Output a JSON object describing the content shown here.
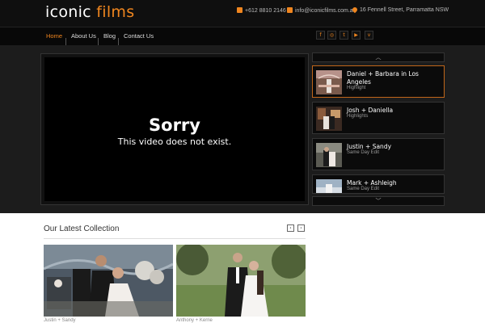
{
  "brand": {
    "word1": "iconic",
    "word2": "films"
  },
  "contact": {
    "phone": "+612 8810 2146",
    "email": "info@iconicfilms.com.au",
    "address": "16 Fennell Street, Parramatta NSW"
  },
  "nav": {
    "items": [
      "Home",
      "About Us",
      "Blog",
      "Contact Us"
    ],
    "active": "Home"
  },
  "social": [
    "facebook-icon",
    "instagram-icon",
    "twitter-icon",
    "youtube-icon",
    "vimeo-icon"
  ],
  "social_glyphs": [
    "f",
    "◎",
    "t",
    "▶",
    "v"
  ],
  "player": {
    "title": "Sorry",
    "message": "This video does not exist."
  },
  "playlist": {
    "up_arrow": "︿",
    "down_arrow": "﹀",
    "items": [
      {
        "title": "Daniel + Barbara in Los Angeles",
        "subtitle": "Highlight"
      },
      {
        "title": "Josh + Daniella",
        "subtitle": "Highlights"
      },
      {
        "title": "Justin + Sandy",
        "subtitle": "Same Day Edit"
      },
      {
        "title": "Mark + Ashleigh",
        "subtitle": "Same Day Edit"
      }
    ]
  },
  "collection": {
    "title": "Our Latest Collection",
    "prev": "‹",
    "next": "›",
    "cards": [
      {
        "caption": "Justin + Sandy"
      },
      {
        "caption": "Anthony + Kerrie"
      }
    ]
  },
  "colors": {
    "accent": "#f0861f",
    "header_bg": "#0f0f0f",
    "body_bg": "#1c1c1c"
  }
}
